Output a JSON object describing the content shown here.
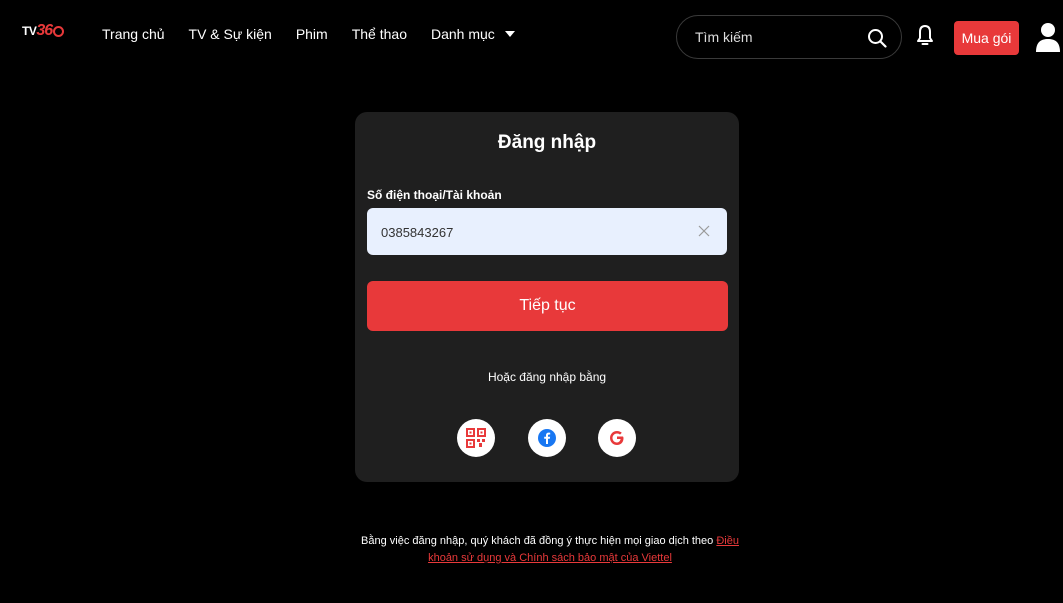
{
  "brand": {
    "logo_tv": "TV",
    "logo_num": "36"
  },
  "nav": {
    "items": [
      {
        "label": "Trang chủ"
      },
      {
        "label": "TV & Sự kiện"
      },
      {
        "label": "Phim"
      },
      {
        "label": "Thể thao"
      },
      {
        "label": "Danh mục"
      }
    ]
  },
  "search": {
    "placeholder": "Tìm kiếm"
  },
  "header": {
    "buy_label": "Mua gói"
  },
  "login": {
    "title": "Đăng nhập",
    "field_label": "Số điện thoại/Tài khoản",
    "phone_value": "0385843267",
    "continue_label": "Tiếp tục",
    "or_text": "Hoặc đăng nhập bằng",
    "social": [
      "qr-code-icon",
      "facebook-icon",
      "google-icon"
    ]
  },
  "terms": {
    "prefix": "Bằng việc đăng nhập, quý khách đã đồng ý thực hiện mọi giao dịch theo",
    "link": "Điều khoản sử dụng và Chính sách bảo mật của Viettel"
  },
  "colors": {
    "accent": "#e8393a",
    "card": "#1f1f1f",
    "input_bg": "#e8f0fe"
  }
}
